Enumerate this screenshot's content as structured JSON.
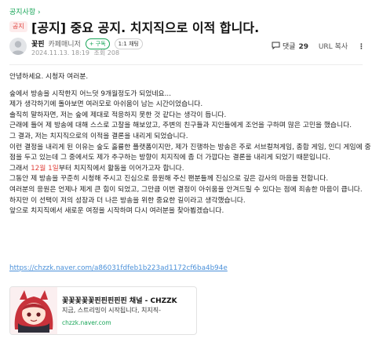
{
  "board": {
    "name": "공지사항"
  },
  "post": {
    "badge": "공지",
    "title": "[공지] 중요 공지. 치지직으로 이적 합니다.",
    "author": {
      "nickname": "꽃핀",
      "role": "카페매니저",
      "follow_label": "+ 구독",
      "chat_label": "1:1 채팅"
    },
    "date": "2024.11.13. 18:19",
    "views_label": "조회 208",
    "comments_label": "댓글",
    "comments_count": "29",
    "url_label": "URL 복사",
    "more_label": "⋮"
  },
  "body": {
    "l1": "안녕하세요. 시청자 여러분.",
    "l2": "숲에서 방송을 시작한지 어느덧 9개월정도가 되었네요...",
    "l3": "제가 생각하기에 돌아보면 여러모로 아쉬움이 남는 시간이었습니다.",
    "l4": "솔직히 말하자면, 저는 숲에 제대로 적응하지 못한 것 같다는 생각이 듭니다.",
    "l5": "근래에 들어 제 방송에 대해 스스로 고찰을 해보았고, 주변의 친구들과 지인들에게 조언을 구하며 많은 고민을 했습니다.",
    "l6": "그 결과, 저는 치지직으로의 이적을 결론을 내리게 되었습니다.",
    "l7": "이런 결정을 내리게 된 이유는 숲도 훌륭한 플랫폼이지만, 제가 진행하는 방송은 주로 서브컬쳐게임, 종합 게임, 인디 게임에 중",
    "l8": "점을 두고 있는데 그 중에서도 제가 추구하는 방향이 치지직에 좀 더 가깝다는 결론을 내리게 되었기 때문입니다.",
    "l9_pre": "그래서 ",
    "l9_red": "12월 1일",
    "l9_post": "부터 치지직에서 활동을 이어가고자 합니다.",
    "l10": "그동안 제 방송을 꾸준히 시청해 주시고 진심으로 응원해 주신 팬분들께 진심으로 깊은 감사의 마음을 전합니다.",
    "l11": "여러분의 응원은 언제나 제게 큰 힘이 되었고, 그만큼 이번 결정이 아쉬움을 안겨드릴 수 있다는 점에 죄송한 마음이 큽니다.",
    "l12": "하지만 이 선택이 저의 성장과 더 나은 방송을 위한 중요한 길이라고 생각했습니다.",
    "l13": "앞으로 치지직에서 새로운 여정을 시작하며 다시 여러분을 찾아뵙겠습니다."
  },
  "link": {
    "url": "https://chzzk.naver.com/a86031fdfeb1b223ad1172cf6ba4b94e"
  },
  "card": {
    "title": "꽃꽃꽃꽃꽃핀핀핀핀핀 채널 - CHZZK",
    "desc": "지금, 스트리밍이 시작됩니다, 치지직-",
    "host": "chzzk.naver.com"
  },
  "colors": {
    "accent": "#18a558",
    "notice_red": "#e0413b",
    "link_blue": "#4a90d9"
  }
}
